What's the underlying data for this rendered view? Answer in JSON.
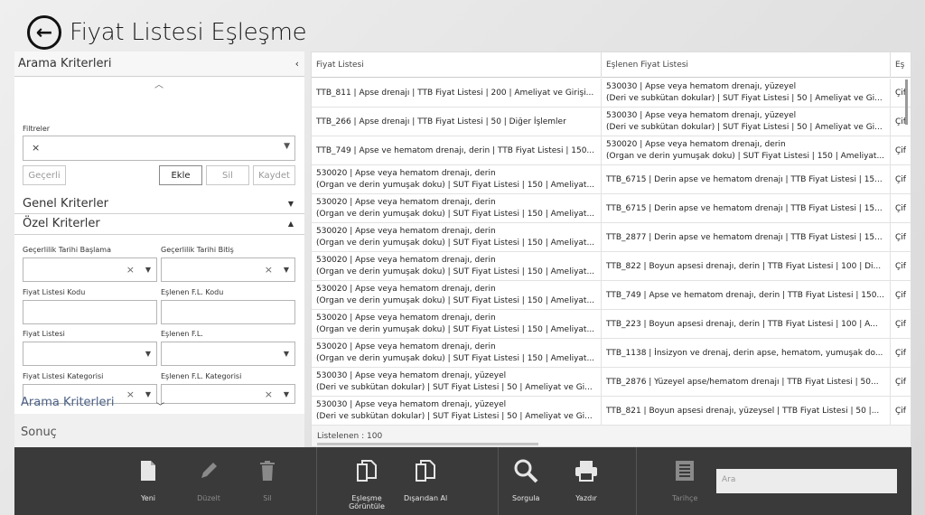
{
  "window": {
    "title": "Fiyat Listesi Eşleşme"
  },
  "left_panel": {
    "header": "Arama Kriterleri",
    "filters_label": "Filtreler",
    "filter_value": "×",
    "buttons": {
      "gecerli": "Geçerli",
      "ekle": "Ekle",
      "sil": "Sil",
      "kaydet": "Kaydet"
    },
    "genel_kriterler": "Genel Kriterler",
    "ozel_kriterler": "Özel Kriterler",
    "fields": {
      "gecerlilik_baslama": "Geçerlilik Tarihi Başlama",
      "gecerlilik_bitis": "Geçerlilik Tarihi Bitiş",
      "fiyat_listesi_kodu": "Fiyat Listesi Kodu",
      "eslenen_fl_kodu": "Eşlenen F.L. Kodu",
      "fiyat_listesi": "Fiyat Listesi",
      "eslenen_fl": "Eşlenen F.L.",
      "fiyat_listesi_kategorisi": "Fiyat Listesi Kategorisi",
      "eslenen_fl_kategorisi": "Eşlenen F.L. Kategorisi"
    },
    "link_arama": "Arama Kriterleri",
    "link_sonuc": "Sonuç"
  },
  "grid": {
    "columns": [
      "Fiyat Listesi",
      "Eşlenen Fiyat Listesi",
      "Eş"
    ],
    "rows": [
      {
        "a": [
          "TTB_811 | Apse drenajı | TTB Fiyat Listesi | 200 | Ameliyat ve Girişi..."
        ],
        "b": [
          "530030 | Apse veya hematom drenajı, yüzeyel",
          "(Deri ve subkütan dokular) | SUT Fiyat Listesi | 50 | Ameliyat ve Gi..."
        ],
        "c": "Çif"
      },
      {
        "a": [
          "TTB_266 | Apse drenajı | TTB Fiyat Listesi | 50 | Diğer İşlemler"
        ],
        "b": [
          "530030 | Apse veya hematom drenajı, yüzeyel",
          "(Deri ve subkütan dokular) | SUT Fiyat Listesi | 50 | Ameliyat ve Gi..."
        ],
        "c": "Çif"
      },
      {
        "a": [
          "TTB_749 | Apse ve hematom drenajı, derin | TTB Fiyat Listesi | 150..."
        ],
        "b": [
          "530020 | Apse veya hematom drenajı, derin",
          "(Organ ve derin yumuşak doku) | SUT Fiyat Listesi | 150 | Ameliyat..."
        ],
        "c": "Çif"
      },
      {
        "a": [
          "530020 | Apse veya hematom drenajı, derin",
          "(Organ ve derin yumuşak doku) | SUT Fiyat Listesi | 150 | Ameliyat..."
        ],
        "b": [
          "TTB_6715 | Derin apse ve hematom drenajı | TTB Fiyat Listesi | 15..."
        ],
        "c": "Çif"
      },
      {
        "a": [
          "530020 | Apse veya hematom drenajı, derin",
          "(Organ ve derin yumuşak doku) | SUT Fiyat Listesi | 150 | Ameliyat..."
        ],
        "b": [
          "TTB_6715 | Derin apse ve hematom drenajı | TTB Fiyat Listesi | 15..."
        ],
        "c": "Çif"
      },
      {
        "a": [
          "530020 | Apse veya hematom drenajı, derin",
          "(Organ ve derin yumuşak doku) | SUT Fiyat Listesi | 150 | Ameliyat..."
        ],
        "b": [
          "TTB_2877 | Derin apse ve hematom drenajı | TTB Fiyat Listesi | 15..."
        ],
        "c": "Çif"
      },
      {
        "a": [
          "530020 | Apse veya hematom drenajı, derin",
          "(Organ ve derin yumuşak doku) | SUT Fiyat Listesi | 150 | Ameliyat..."
        ],
        "b": [
          "TTB_822 | Boyun apsesi drenajı, derin | TTB Fiyat Listesi | 100 | Di..."
        ],
        "c": "Çif"
      },
      {
        "a": [
          "530020 | Apse veya hematom drenajı, derin",
          "(Organ ve derin yumuşak doku) | SUT Fiyat Listesi | 150 | Ameliyat..."
        ],
        "b": [
          "TTB_749 | Apse ve hematom drenajı, derin | TTB Fiyat Listesi | 150..."
        ],
        "c": "Çif"
      },
      {
        "a": [
          "530020 | Apse veya hematom drenajı, derin",
          "(Organ ve derin yumuşak doku) | SUT Fiyat Listesi | 150 | Ameliyat..."
        ],
        "b": [
          "TTB_223 | Boyun apsesi drenajı, derin | TTB Fiyat Listesi | 100 | A..."
        ],
        "c": "Çif"
      },
      {
        "a": [
          "530020 | Apse veya hematom drenajı, derin",
          "(Organ ve derin yumuşak doku) | SUT Fiyat Listesi | 150 | Ameliyat..."
        ],
        "b": [
          "TTB_1138 | İnsizyon ve drenaj, derin apse, hematom, yumuşak do..."
        ],
        "c": "Çif"
      },
      {
        "a": [
          "530030 | Apse veya hematom drenajı, yüzeyel",
          "(Deri ve subkütan dokular) | SUT Fiyat Listesi | 50 | Ameliyat ve Gi..."
        ],
        "b": [
          "TTB_2876 | Yüzeyel apse/hematom drenajı | TTB Fiyat Listesi | 50..."
        ],
        "c": "Çif"
      },
      {
        "a": [
          "530030 | Apse veya hematom drenajı, yüzeyel",
          "(Deri ve subkütan dokular) | SUT Fiyat Listesi | 50 | Ameliyat ve Gi..."
        ],
        "b": [
          "TTB_821 | Boyun apsesi drenajı, yüzeysel | TTB Fiyat Listesi | 50 |..."
        ],
        "c": "Çif"
      }
    ],
    "footer": "Listelenen :   100"
  },
  "appbar": {
    "yeni": "Yeni",
    "duzelt": "Düzelt",
    "sil": "Sil",
    "eslesme_l1": "Eşleşme",
    "eslesme_l2": "Görüntüle",
    "disaridan_al": "Dışarıdan Al",
    "sorgula": "Sorgula",
    "yazdir": "Yazdır",
    "tarihce": "Tarihçe",
    "search_placeholder": "Ara"
  }
}
